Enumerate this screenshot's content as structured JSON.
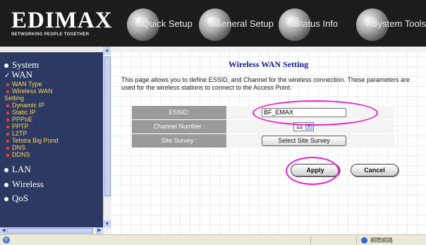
{
  "header": {
    "logo": "EDIMAX",
    "tagline": "NETWORKING PEOPLE TOGETHER",
    "tabs": [
      {
        "label": "Quick Setup",
        "icon": "quick-setup-icon"
      },
      {
        "label": "General Setup",
        "icon": "general-setup-icon"
      },
      {
        "label": "Status Info",
        "icon": "status-info-icon"
      },
      {
        "label": "System Tools",
        "icon": "system-tools-icon"
      }
    ]
  },
  "sidebar": {
    "sections": [
      {
        "label": "System"
      },
      {
        "label": "WAN"
      },
      {
        "label": "LAN"
      },
      {
        "label": "Wireless"
      },
      {
        "label": "QoS"
      }
    ],
    "wan_items": [
      "WAN Type",
      "Wireless WAN",
      "Setting",
      "Dynamic IP",
      "Static IP",
      "PPPoE",
      "PPTP",
      "L2TP",
      "Telstra Big Pond",
      "DNS",
      "DDNS"
    ]
  },
  "main": {
    "title": "Wireless WAN Setting",
    "description": "This page allows you to define ESSID, and Channel for the wireless connection. These parameters are used for the wireless stations to connect to the Access Point.",
    "essid": {
      "label": "ESSID:",
      "value": "BF_EMAX"
    },
    "channel": {
      "label": "Channel Number :",
      "value": "11"
    },
    "site_survey": {
      "label": "Site Survey :",
      "button": "Select Site Survey"
    },
    "apply": "Apply",
    "cancel": "Cancel"
  },
  "statusbar": {
    "zone": "網際網路"
  },
  "colors": {
    "header_bg": "#1c1c1c",
    "sidebar_bg": "#2c3a63",
    "title_color": "#1a1a8c",
    "highlight": "#e51fd2",
    "label_bg": "#9a9a9a"
  }
}
